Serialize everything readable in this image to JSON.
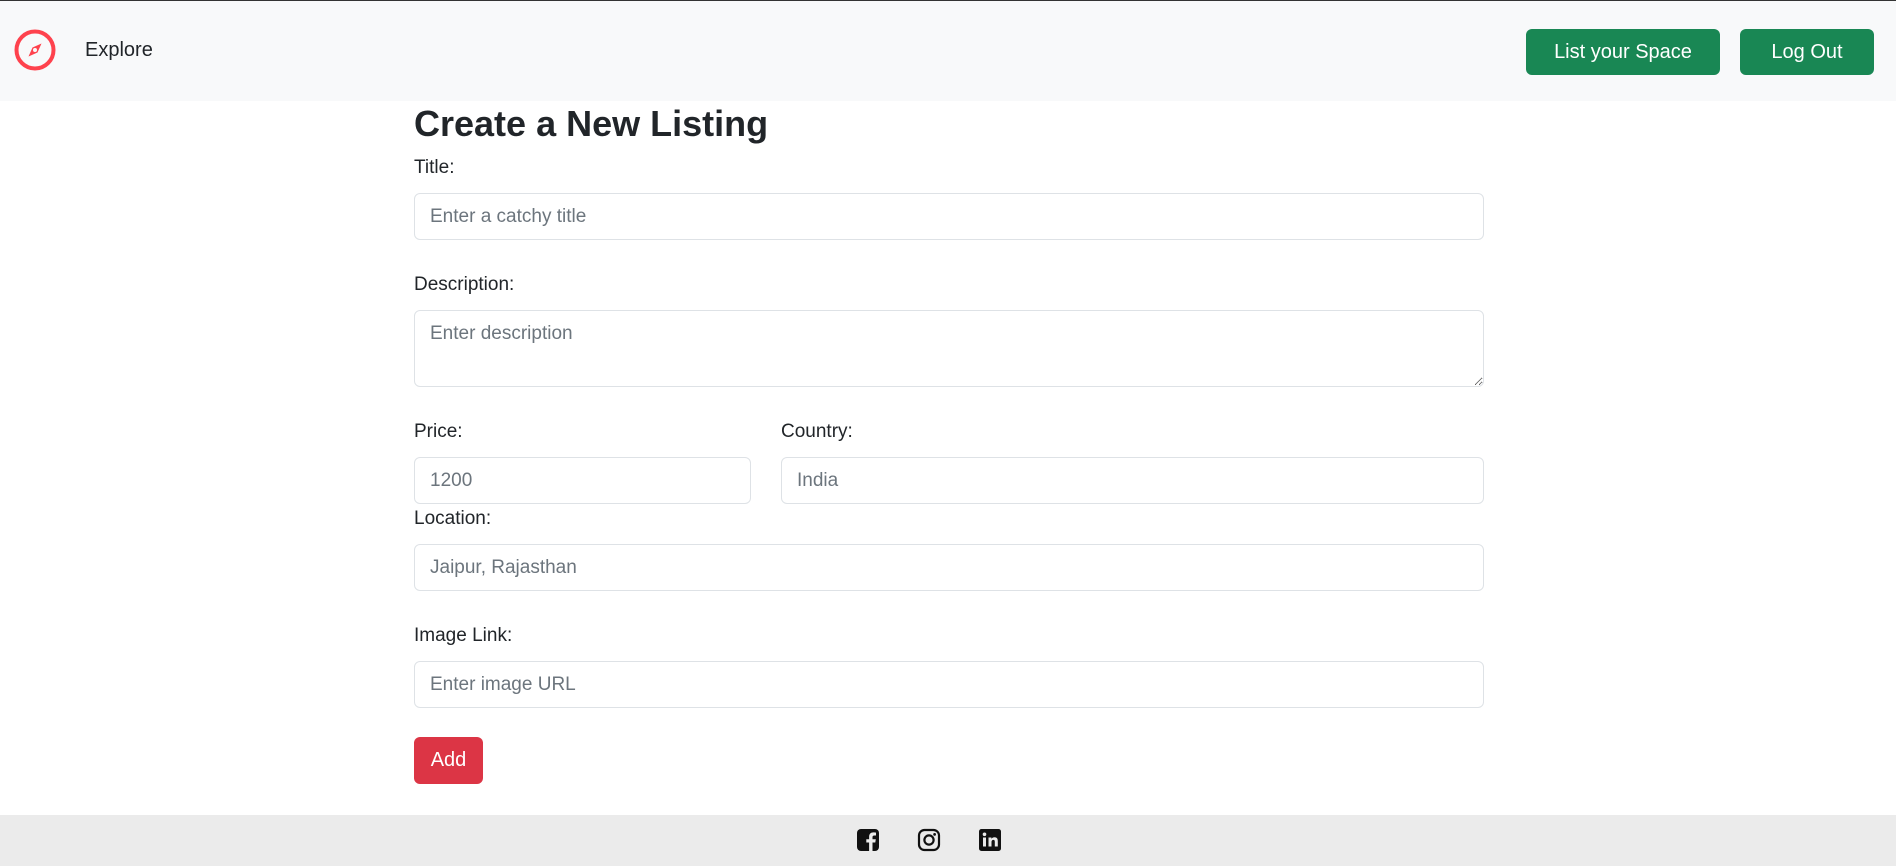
{
  "navbar": {
    "brand_icon": "compass-icon",
    "explore_label": "Explore",
    "list_space_label": "List your Space",
    "logout_label": "Log Out",
    "accent_color": "#198754",
    "brand_color": "#fe424d"
  },
  "form": {
    "title": "Create a New Listing",
    "title_label": "Title:",
    "title_placeholder": "Enter a catchy title",
    "description_label": "Description:",
    "description_placeholder": "Enter description",
    "price_label": "Price:",
    "price_placeholder": "1200",
    "country_label": "Country:",
    "country_placeholder": "India",
    "location_label": "Location:",
    "location_placeholder": "Jaipur, Rajasthan",
    "image_label": "Image Link:",
    "image_placeholder": "Enter image URL",
    "add_label": "Add",
    "add_color": "#dc3545"
  },
  "footer": {
    "icons": [
      "facebook-icon",
      "instagram-icon",
      "linkedin-icon"
    ]
  }
}
